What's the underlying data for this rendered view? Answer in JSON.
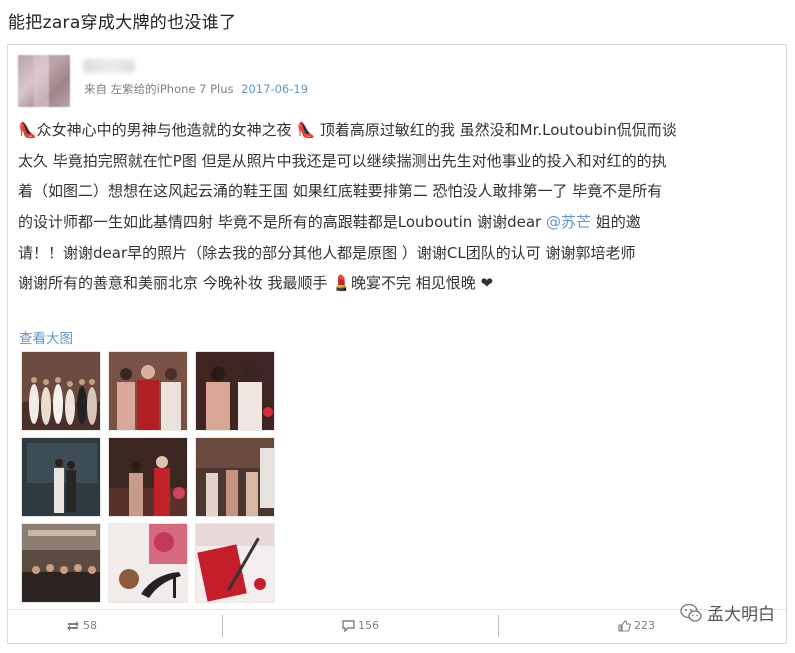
{
  "headline": "能把zara穿成大牌的也没谁了",
  "post": {
    "source_prefix": "来自",
    "source_device": "左紫给的iPhone 7 Plus",
    "date": "2017-06-19",
    "lines": [
      "👠众女神心中的男神与他造就的女神之夜 👠 顶着高原过敏红的我 虽然没和Mr.Loutoubin侃侃而谈",
      "太久 毕竟拍完照就在忙P图 但是从照片中我还是可以继续揣测出先生对他事业的投入和对红的的执",
      "着（如图二）想想在这风起云涌的鞋王国 如果红底鞋要排第二 恐怕没人敢排第一了 毕竟不是所有",
      "的设计师都一生如此基情四射 毕竟不是所有的高跟鞋都是Louboutin 谢谢dear",
      "请！！谢谢dear早的照片（除去我的部分其他人都是原图 ）谢谢CL团队的认可 谢谢郭培老师",
      "谢谢所有的善意和美丽北京 今晚补妆 我最顺手 💄晚宴不完 相见恨晚 ❤"
    ],
    "mention": "@苏芒",
    "after_mention": " 姐的邀",
    "view_large": "查看大图"
  },
  "footer": {
    "repost_count": "58",
    "comment_count": "156",
    "like_count": "223"
  },
  "watermark": "孟大明白",
  "icons": {
    "repost": "repost-icon",
    "comment": "comment-icon",
    "like": "like-icon",
    "wechat": "wechat-icon"
  },
  "colors": {
    "link": "#5f96c8",
    "text": "#333333",
    "meta": "#808080"
  }
}
